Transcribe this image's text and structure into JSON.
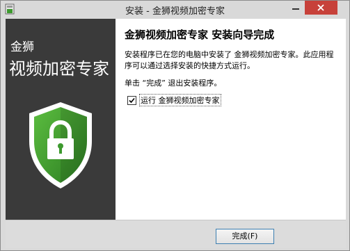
{
  "window": {
    "title": "安装 - 金狮视频加密专家",
    "app_icon": "installer-icon",
    "minimize_icon": "minimize-icon",
    "close_icon": "close-icon",
    "close_color": "#c7413a"
  },
  "sidebar": {
    "brand_line1": "金狮",
    "brand_line2": "视频加密专家",
    "logo_icon": "shield-lock-icon",
    "background": "#3a3a3a",
    "shield_color": "#3d9a2e"
  },
  "content": {
    "heading": "金狮视频加密专家 安装向导完成",
    "paragraph": "安装程序已在您的电脑中安装了 金狮视频加密专家。此应用程序可以通过选择安装的快捷方式运行。",
    "hint": "单击 “完成” 退出安装程序。",
    "run_checkbox": {
      "label": "运行 金狮视频加密专家",
      "checked": true
    }
  },
  "footer": {
    "finish_button": "完成(F)"
  }
}
